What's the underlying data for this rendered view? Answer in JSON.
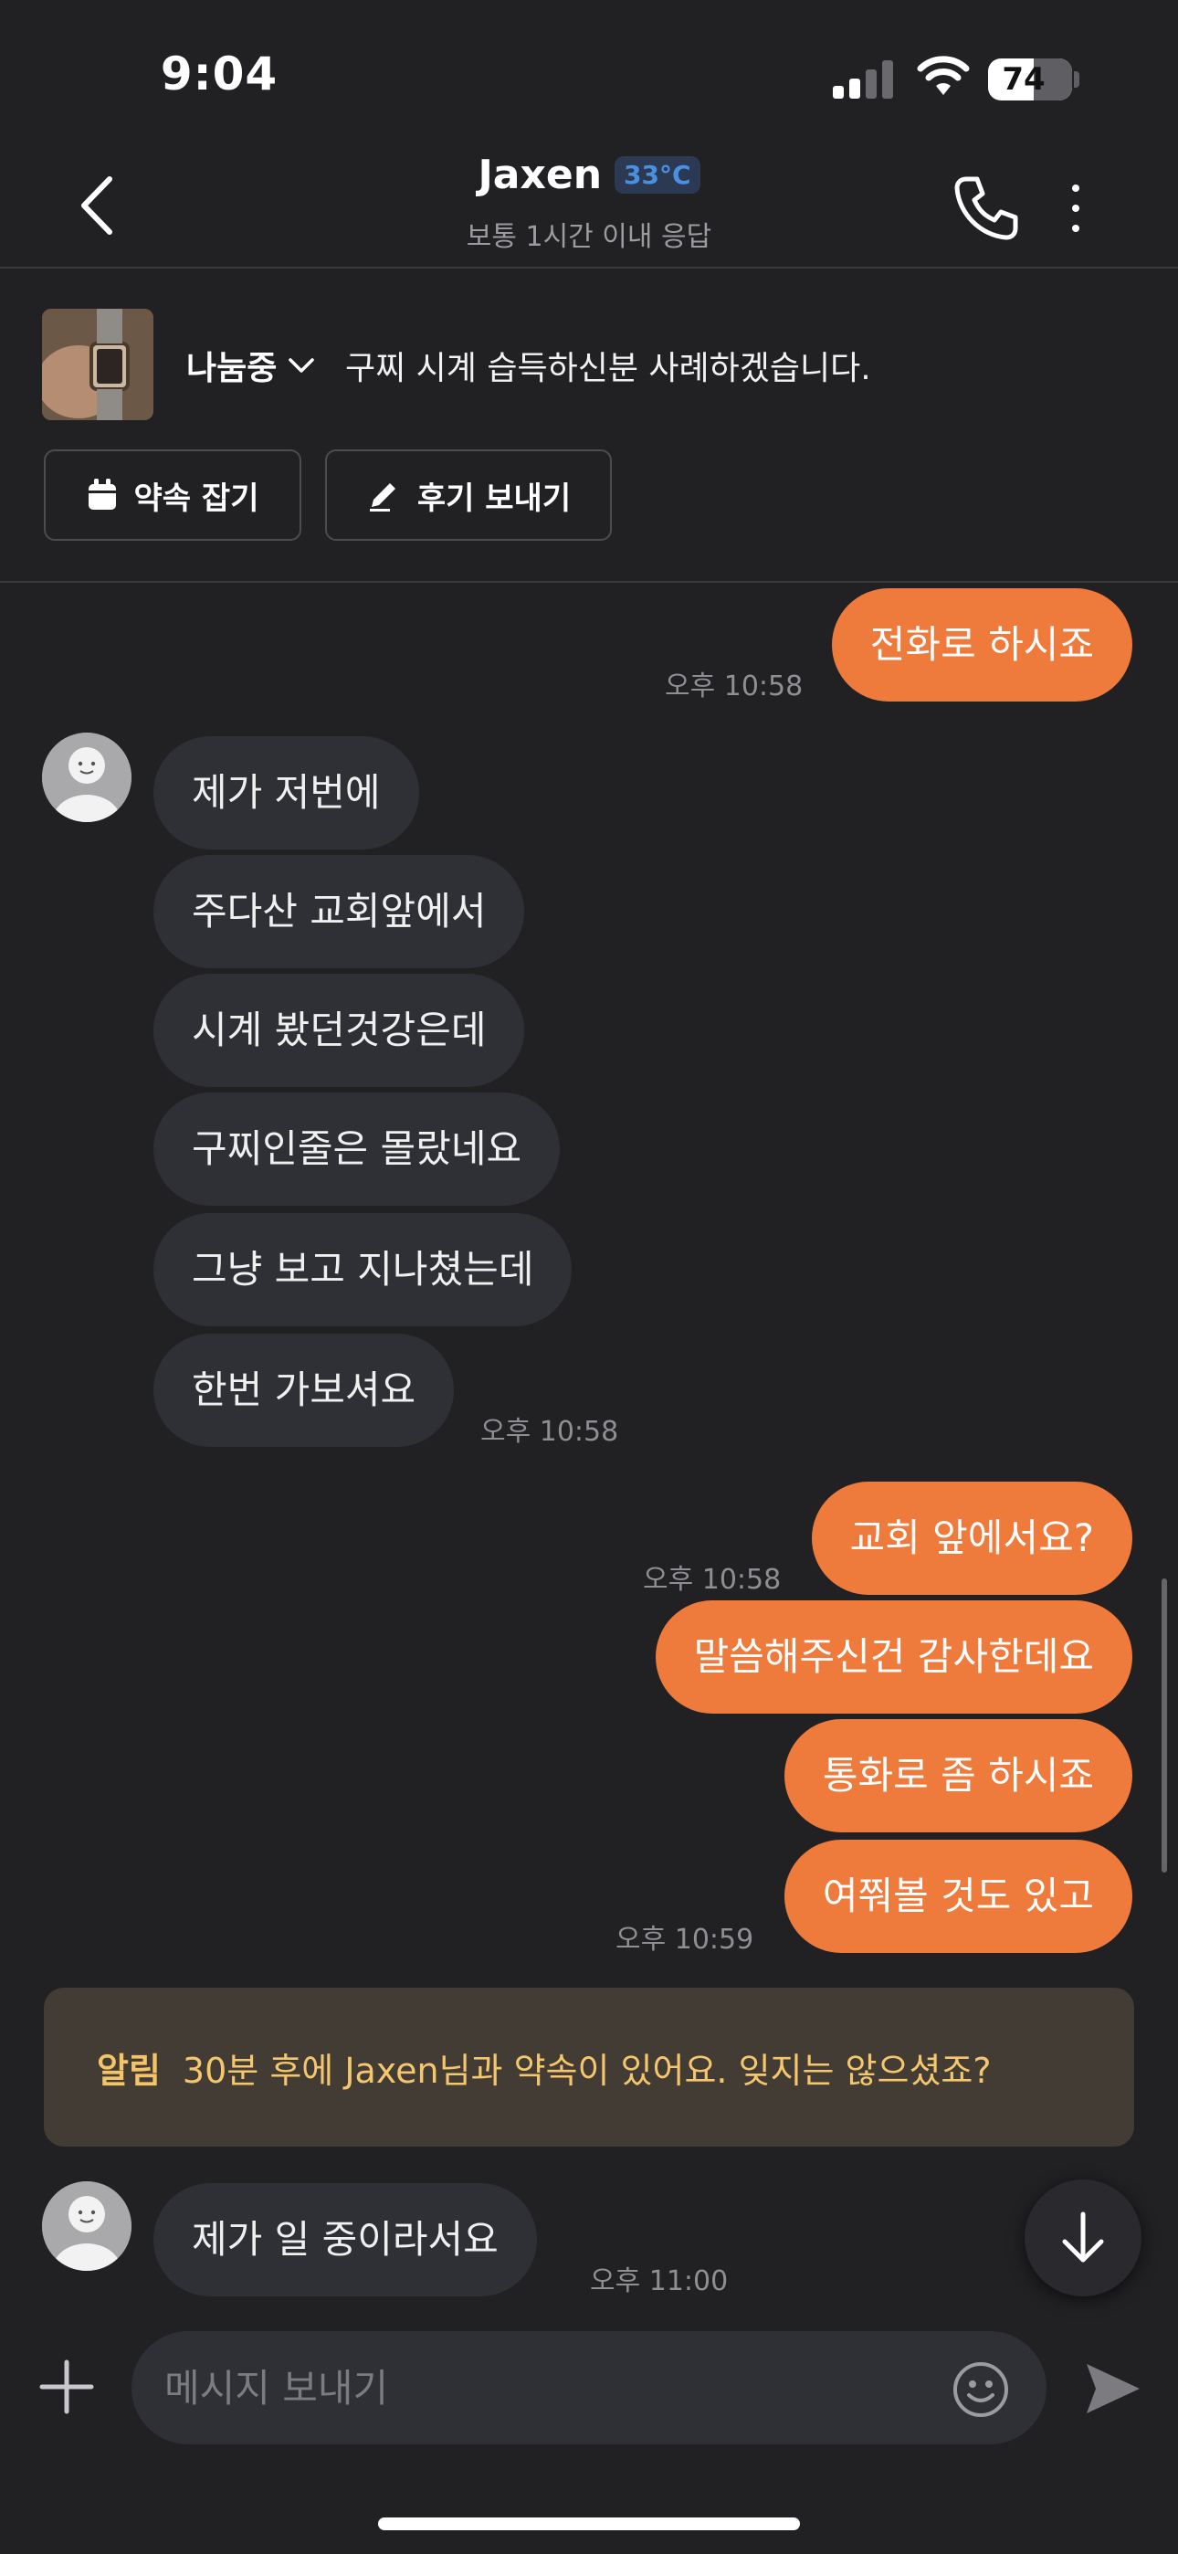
{
  "status_bar": {
    "time": "9:04",
    "battery": "74"
  },
  "header": {
    "name": "Jaxen",
    "temperature": "33°C",
    "response_time": "보통 1시간 이내 응답",
    "back_icon": "chevron-left-icon",
    "call_icon": "phone-icon",
    "more_icon": "more-vertical-icon"
  },
  "product": {
    "status": "나눔중",
    "title": "구찌 시계 습득하신분 사례하겠습니다.",
    "buttons": [
      {
        "label": "약속 잡기",
        "icon": "calendar-icon"
      },
      {
        "label": "후기 보내기",
        "icon": "pencil-icon"
      }
    ]
  },
  "messages": [
    {
      "direction": "out",
      "text": "전화로 하시죠",
      "time": "오후 10:58"
    },
    {
      "direction": "in",
      "text": "제가 저번에"
    },
    {
      "direction": "in",
      "text": "주다산 교회앞에서"
    },
    {
      "direction": "in",
      "text": "시계 봤던것강은데"
    },
    {
      "direction": "in",
      "text": "구찌인줄은 몰랐네요"
    },
    {
      "direction": "in",
      "text": "그냥 보고 지나쳤는데"
    },
    {
      "direction": "in",
      "text": "한번 가보셔요",
      "time": "오후 10:58"
    },
    {
      "direction": "out",
      "text": "교회 앞에서요?",
      "time": "오후 10:58"
    },
    {
      "direction": "out",
      "text": "말씀해주신건 감사한데요"
    },
    {
      "direction": "out",
      "text": "통화로 좀 하시죠"
    },
    {
      "direction": "out",
      "text": "여쭤볼 것도 있고",
      "time": "오후 10:59"
    },
    {
      "direction": "in",
      "text": "제가  일  중이라서요",
      "time": "오후 11:00"
    }
  ],
  "notice": {
    "label": "알림",
    "text": "30분 후에 Jaxen님과 약속이 있어요. 잊지는 않으셨죠?"
  },
  "composer": {
    "placeholder": "메시지 보내기",
    "plus_icon": "plus-icon",
    "emoji_icon": "smiley-icon",
    "send_icon": "send-icon"
  },
  "colors": {
    "background": "#212124",
    "outgoing_bubble": "#ee7a3c",
    "incoming_bubble": "#2e3035",
    "notice_bg": "#433c34",
    "notice_text": "#f4c76e",
    "temperature_badge": "#4a90e2"
  }
}
